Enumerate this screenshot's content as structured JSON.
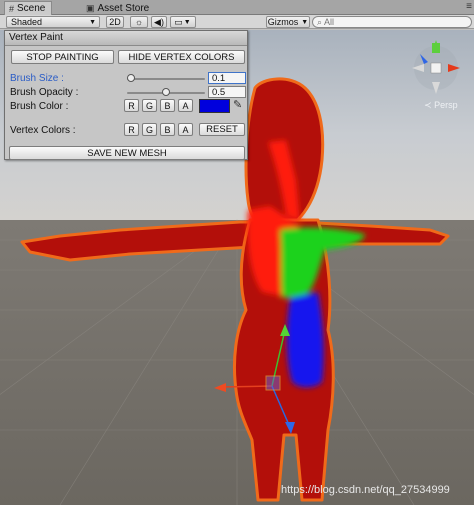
{
  "tabs": [
    {
      "label": "Scene",
      "icon": "grid-icon",
      "active": true
    },
    {
      "label": "Asset Store",
      "icon": "store-icon",
      "active": false
    }
  ],
  "toolbar": {
    "shading_mode": "Shaded",
    "mode_2d": "2D",
    "gizmos_label": "Gizmos",
    "search_placeholder": "All"
  },
  "panel": {
    "title": "Vertex Paint",
    "stop_painting_label": "STOP PAINTING",
    "hide_colors_label": "HIDE VERTEX COLORS",
    "brush_size_label": "Brush Size :",
    "brush_size_value": "0.1",
    "brush_size_fraction": 0.05,
    "brush_opacity_label": "Brush Opacity :",
    "brush_opacity_value": "0.5",
    "brush_opacity_fraction": 0.5,
    "brush_color_label": "Brush Color :",
    "brush_color": "#0000dd",
    "vertex_colors_label": "Vertex Colors :",
    "channels": [
      "R",
      "G",
      "B",
      "A"
    ],
    "reset_label": "RESET",
    "save_label": "SAVE NEW MESH"
  },
  "gizmo": {
    "projection_label": "Persp"
  },
  "watermark": "https://blog.csdn.net/qq_27534999"
}
